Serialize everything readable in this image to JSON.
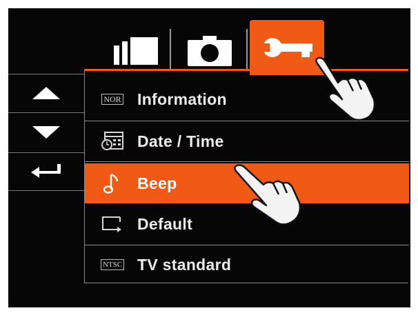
{
  "tabs": [
    {
      "id": "view",
      "icon": "playback-view-icon",
      "selected": false
    },
    {
      "id": "camera",
      "icon": "camera-icon",
      "selected": false
    },
    {
      "id": "settings",
      "icon": "wrench-icon",
      "selected": true
    }
  ],
  "nav": {
    "up_icon": "up-arrow-icon",
    "down_icon": "down-arrow-icon",
    "enter_icon": "enter-return-icon"
  },
  "menu": {
    "items": [
      {
        "icon_text": "NOR",
        "label": "Information",
        "selected": false
      },
      {
        "icon": "calendar-clock-icon",
        "label": "Date / Time",
        "selected": false
      },
      {
        "icon": "music-note-icon",
        "label": "Beep",
        "selected": true
      },
      {
        "icon": "screen-reset-icon",
        "label": "Default",
        "selected": false
      },
      {
        "icon_text": "NTSC",
        "label": "TV standard",
        "selected": false
      }
    ]
  },
  "colors": {
    "accent": "#f05a14",
    "background": "#060606",
    "text": "#ececec",
    "line": "#8c8c8c"
  }
}
